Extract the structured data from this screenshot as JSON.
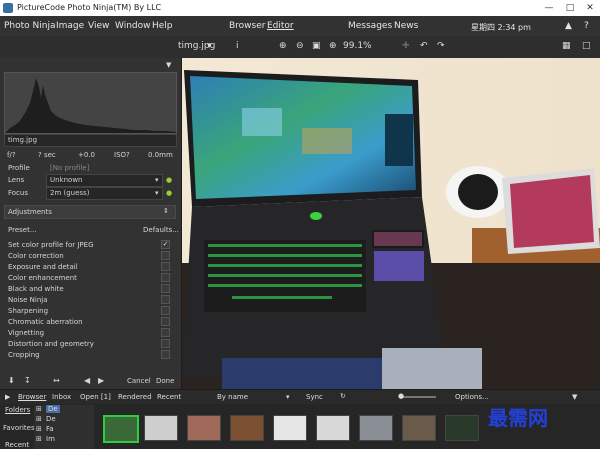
{
  "window": {
    "title": "PictureCode Photo Ninja(TM) By LLC"
  },
  "menu": {
    "items": [
      "Photo Ninja",
      "Image",
      "View",
      "Window",
      "Help"
    ],
    "right": [
      "Browser",
      "Editor",
      "Messages",
      "News"
    ],
    "clock": "星期四 2:34 pm"
  },
  "toolbar": {
    "filename": "timg.jpg",
    "zoom": "99.1%"
  },
  "left": {
    "file": "timg.jpg",
    "exif": {
      "aperture": "f/?",
      "shutter": "? sec",
      "ev": "+0.0",
      "iso": "ISO?",
      "focal": "0.0mm"
    },
    "profile_label": "Profile",
    "profile_value": "[No profile]",
    "lens_label": "Lens",
    "lens_value": "Unknown",
    "focus_label": "Focus",
    "focus_value": "2m (guess)",
    "adjustments_label": "Adjustments",
    "preset_label": "Preset...",
    "defaults_label": "Defaults...",
    "adjustments": [
      "Set color profile for JPEG",
      "Color correction",
      "Exposure and detail",
      "Color enhancement",
      "Black and white",
      "Noise Ninja",
      "Sharpening",
      "Chromatic aberration",
      "Vignetting",
      "Distortion and geometry",
      "Cropping"
    ],
    "cancel_label": "Cancel",
    "done_label": "Done"
  },
  "strip": {
    "tabs": [
      "Browser",
      "Inbox",
      "Open [1]",
      "Rendered",
      "Recent"
    ],
    "sort": "By name",
    "sync": "Sync",
    "options": "Options...",
    "folders_label": "Folders",
    "favorites_label": "Favorites",
    "recent_label": "Recent",
    "tree": [
      "De",
      "De",
      "Fa",
      "Im"
    ]
  },
  "watermark": "最需网"
}
